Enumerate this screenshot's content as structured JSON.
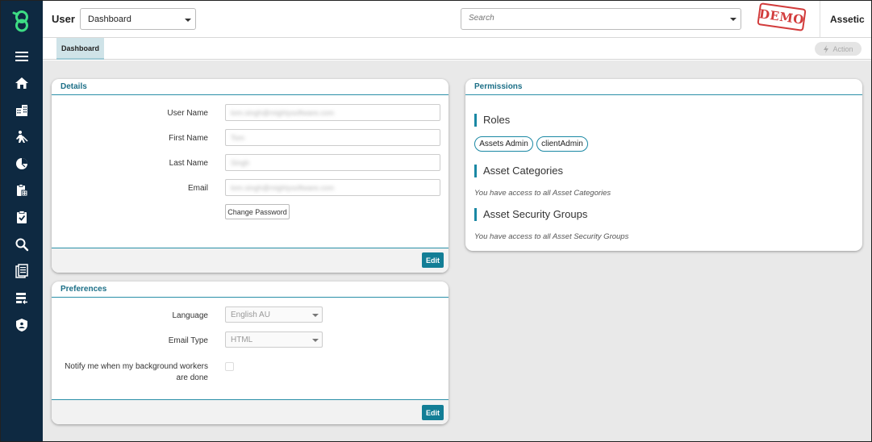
{
  "header": {
    "page_title": "User",
    "view_select": "Dashboard",
    "search_placeholder": "Search",
    "demo_stamp": "DEMO",
    "brand": "Assetic"
  },
  "tabs": [
    {
      "label": "Dashboard",
      "active": true
    }
  ],
  "action_button": "Action",
  "sidebar": {
    "logo": "assetic-logo",
    "items": [
      {
        "icon": "menu-icon"
      },
      {
        "icon": "home-icon"
      },
      {
        "icon": "buildings-icon"
      },
      {
        "icon": "worker-icon"
      },
      {
        "icon": "pie-chart-icon"
      },
      {
        "icon": "clipboard-grid-icon"
      },
      {
        "icon": "clipboard-check-icon"
      },
      {
        "icon": "search-icon"
      },
      {
        "icon": "documents-icon"
      },
      {
        "icon": "list-import-icon"
      },
      {
        "icon": "shield-icon"
      }
    ]
  },
  "details": {
    "title": "Details",
    "fields": [
      {
        "label": "User Name",
        "value": "tom.singh@mightysoftware.com"
      },
      {
        "label": "First Name",
        "value": "Tom"
      },
      {
        "label": "Last Name",
        "value": "Singh"
      },
      {
        "label": "Email",
        "value": "tom.singh@mightysoftware.com"
      }
    ],
    "change_password": "Change Password",
    "edit": "Edit"
  },
  "preferences": {
    "title": "Preferences",
    "language_label": "Language",
    "language_value": "English AU",
    "email_type_label": "Email Type",
    "email_type_value": "HTML",
    "notify_label_line1": "Notify me when my background workers",
    "notify_label_line2": "are done",
    "notify_checked": false,
    "edit": "Edit"
  },
  "permissions": {
    "title": "Permissions",
    "roles_title": "Roles",
    "roles": [
      "Assets Admin",
      "clientAdmin"
    ],
    "asset_categories_title": "Asset Categories",
    "asset_categories_note": "You have access to all Asset Categories",
    "asset_security_groups_title": "Asset Security Groups",
    "asset_security_groups_note": "You have access to all Asset Security Groups"
  },
  "colors": {
    "sidebar": "#0e2941",
    "logo": "#3ddc84",
    "accent": "#137e96",
    "demo": "#d23b3b"
  }
}
